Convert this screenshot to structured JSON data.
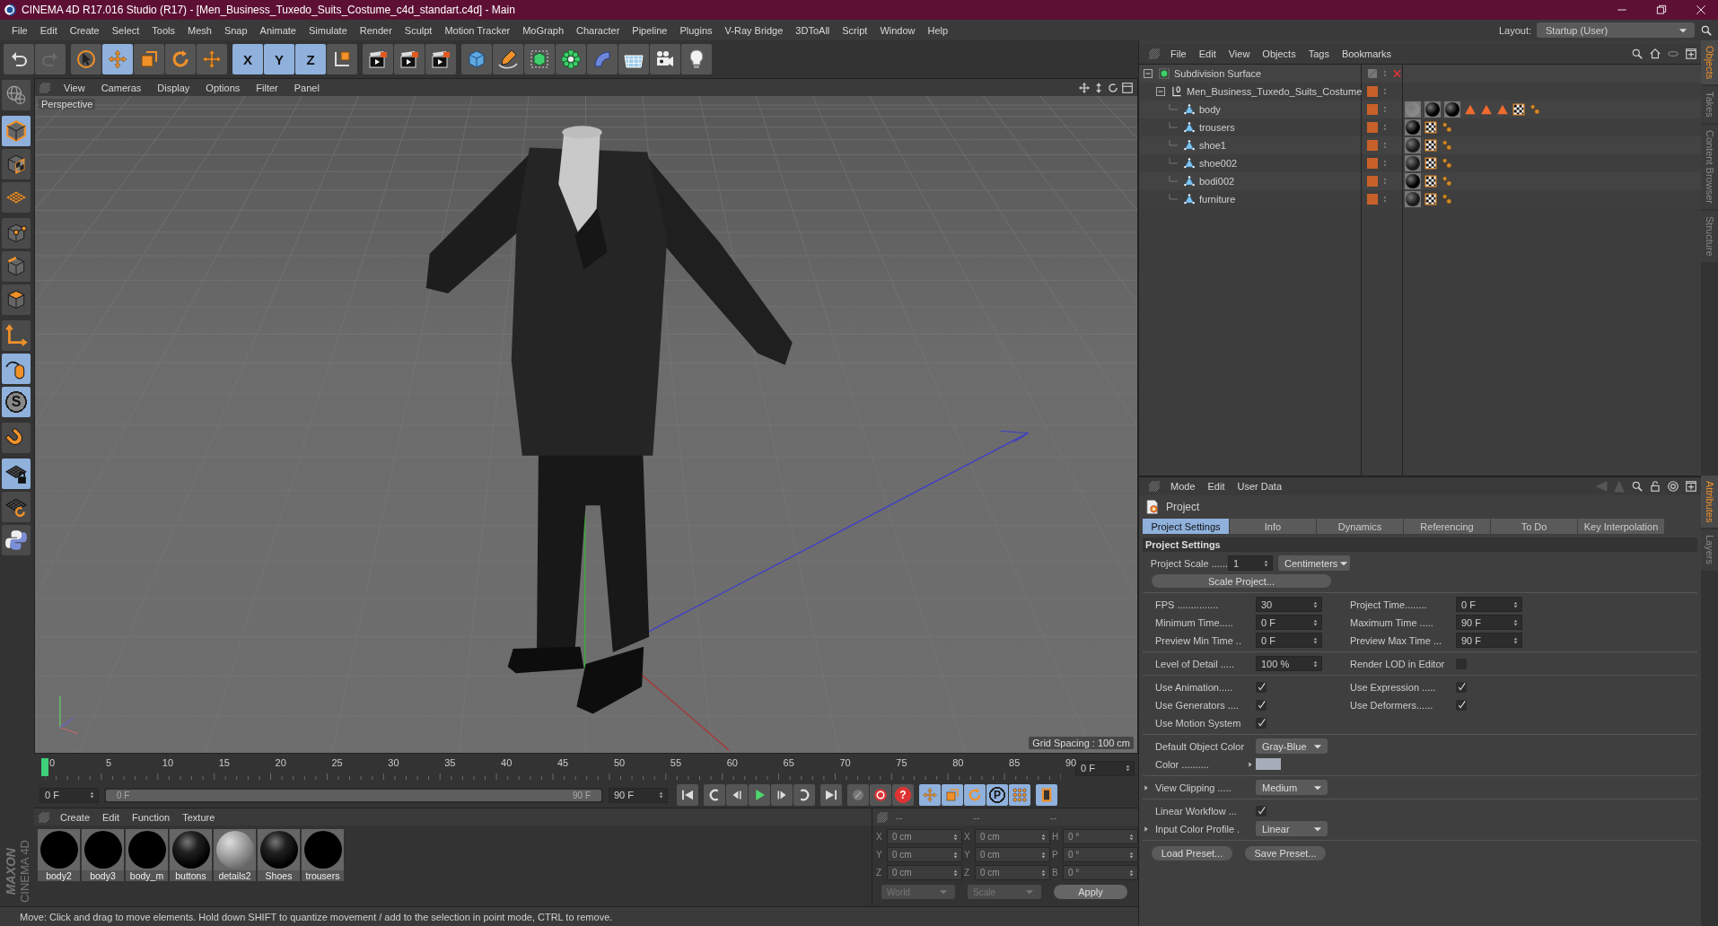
{
  "window": {
    "title": "CINEMA 4D R17.016 Studio (R17) - [Men_Business_Tuxedo_Suits_Costume_c4d_standart.c4d] - Main"
  },
  "menu_bar": [
    "File",
    "Edit",
    "Create",
    "Select",
    "Tools",
    "Mesh",
    "Snap",
    "Animate",
    "Simulate",
    "Render",
    "Sculpt",
    "Motion Tracker",
    "MoGraph",
    "Character",
    "Pipeline",
    "Plugins",
    "V-Ray Bridge",
    "3DToAll",
    "Script",
    "Window",
    "Help"
  ],
  "layout": {
    "label": "Layout:",
    "value": "Startup (User)"
  },
  "toolbar": [
    [
      {
        "kind": "undo",
        "selected": false
      },
      {
        "kind": "redo",
        "selected": false
      }
    ],
    [
      {
        "kind": "cursor",
        "selected": false
      },
      {
        "kind": "move",
        "selected": true
      },
      {
        "kind": "scale",
        "selected": false
      },
      {
        "kind": "rotate",
        "selected": false
      },
      {
        "kind": "moveplus",
        "selected": false
      }
    ],
    [
      {
        "kind": "axislock",
        "label": "X",
        "selected": true
      },
      {
        "kind": "axislock",
        "label": "Y",
        "selected": true
      },
      {
        "kind": "axislock",
        "label": "Z",
        "selected": true
      },
      {
        "kind": "axes",
        "selected": false
      }
    ],
    [
      {
        "kind": "render",
        "selected": false
      },
      {
        "kind": "render",
        "selected": false
      },
      {
        "kind": "render",
        "selected": false
      }
    ],
    [
      {
        "kind": "cube",
        "selected": false
      },
      {
        "kind": "pen",
        "selected": false
      },
      {
        "kind": "subdiv",
        "selected": false
      },
      {
        "kind": "cloner",
        "selected": false
      },
      {
        "kind": "bend",
        "selected": false
      },
      {
        "kind": "floor",
        "selected": false
      },
      {
        "kind": "camera",
        "selected": false
      },
      {
        "kind": "bulb",
        "selected": false
      }
    ]
  ],
  "left_toolbar": [
    [
      {
        "kind": "globe",
        "selected": false
      }
    ],
    [
      {
        "kind": "cubeoutline",
        "selected": true
      },
      {
        "kind": "checkercube",
        "selected": false
      },
      {
        "kind": "gridplane",
        "selected": false
      }
    ],
    [
      {
        "kind": "cubepoints",
        "selected": false
      },
      {
        "kind": "cubeedges",
        "selected": false
      },
      {
        "kind": "cubeface",
        "selected": false
      }
    ],
    [
      {
        "kind": "axisl",
        "selected": false
      },
      {
        "kind": "mouse",
        "selected": true
      },
      {
        "kind": "sculpt",
        "label": "S",
        "selected": true
      }
    ],
    [
      {
        "kind": "magnet",
        "selected": false
      }
    ],
    [
      {
        "kind": "gridlock",
        "selected": true
      },
      {
        "kind": "gridrotate",
        "selected": false
      },
      {
        "kind": "python",
        "selected": false
      }
    ]
  ],
  "brand": {
    "company": "MAXON",
    "product": "CINEMA 4D"
  },
  "viewport": {
    "menu": [
      "View",
      "Cameras",
      "Display",
      "Options",
      "Filter",
      "Panel"
    ],
    "label": "Perspective",
    "grid_spacing": "Grid Spacing : 100 cm"
  },
  "timeline": {
    "ticks": [
      "0",
      "5",
      "10",
      "15",
      "20",
      "25",
      "30",
      "35",
      "40",
      "45",
      "50",
      "55",
      "60",
      "65",
      "70",
      "75",
      "80",
      "85",
      "90"
    ],
    "frame_field": "0 F"
  },
  "transport": {
    "start_field": "0 F",
    "range": {
      "start": "0 F",
      "end": "90 F",
      "level": 1
    },
    "end_field": "90 F",
    "buttons": [
      [
        {
          "kind": "first",
          "selected": false
        }
      ],
      [
        {
          "kind": "prevkey",
          "selected": false
        },
        {
          "kind": "stepback",
          "selected": false
        },
        {
          "kind": "play",
          "selected": false
        },
        {
          "kind": "stepfwd",
          "selected": false
        },
        {
          "kind": "nextkey",
          "selected": false
        }
      ],
      [
        {
          "kind": "last",
          "selected": false
        }
      ],
      [
        {
          "kind": "key",
          "selected": false
        },
        {
          "kind": "record",
          "selected": false
        },
        {
          "kind": "question",
          "label": "?",
          "selected": false
        }
      ],
      [
        {
          "kind": "move",
          "selected": true
        },
        {
          "kind": "scale",
          "selected": true
        },
        {
          "kind": "rotate",
          "selected": true
        },
        {
          "kind": "pmode",
          "label": "P",
          "selected": true
        },
        {
          "kind": "dots",
          "selected": true
        }
      ],
      [
        {
          "kind": "film",
          "selected": true
        }
      ]
    ]
  },
  "material_manager": {
    "menu": [
      "Create",
      "Edit",
      "Function",
      "Texture"
    ],
    "materials": [
      {
        "name": "body2",
        "kind": "matte"
      },
      {
        "name": "body3",
        "kind": "matte"
      },
      {
        "name": "body_m",
        "kind": "matte"
      },
      {
        "name": "buttons",
        "kind": "glossy"
      },
      {
        "name": "details2",
        "kind": "gray"
      },
      {
        "name": "Shoes",
        "kind": "glossy"
      },
      {
        "name": "trousers",
        "kind": "matte"
      }
    ]
  },
  "coordinates": {
    "headers": [
      "--",
      "--",
      "--"
    ],
    "rows": [
      [
        {
          "label": "X",
          "value": "0 cm"
        },
        {
          "label": "X",
          "value": "0 cm"
        },
        {
          "label": "H",
          "value": "0 °"
        }
      ],
      [
        {
          "label": "Y",
          "value": "0 cm"
        },
        {
          "label": "Y",
          "value": "0 cm"
        },
        {
          "label": "P",
          "value": "0 °"
        }
      ],
      [
        {
          "label": "Z",
          "value": "0 cm"
        },
        {
          "label": "Z",
          "value": "0 cm"
        },
        {
          "label": "B",
          "value": "0 °"
        }
      ]
    ],
    "dropdowns": [
      "World",
      "Scale"
    ],
    "apply": "Apply"
  },
  "status_bar": "Move: Click and drag to move elements. Hold down SHIFT to quantize movement / add to the selection in point mode, CTRL to remove.",
  "object_manager": {
    "menu": [
      "File",
      "Edit",
      "View",
      "Objects",
      "Tags",
      "Bookmarks"
    ],
    "objects": [
      {
        "name": "Subdivision Surface",
        "kind": "subdiv",
        "expanded": true,
        "enabled": false,
        "children": [
          {
            "name": "Men_Business_Tuxedo_Suits_Costume",
            "kind": "null",
            "expanded": true,
            "children": [
              {
                "name": "body",
                "kind": "polygon",
                "tags": [
                  {
                    "kind": "material",
                    "color": "#8a8a8a"
                  },
                  {
                    "kind": "material",
                    "color": "#000000"
                  },
                  {
                    "kind": "material",
                    "color": "#000000"
                  },
                  {
                    "kind": "selection"
                  },
                  {
                    "kind": "selection"
                  },
                  {
                    "kind": "selection"
                  },
                  {
                    "kind": "texture"
                  },
                  {
                    "kind": "uvw"
                  }
                ]
              },
              {
                "name": "trousers",
                "kind": "polygon",
                "tags": [
                  {
                    "kind": "material",
                    "color": "#000000"
                  },
                  {
                    "kind": "texture"
                  },
                  {
                    "kind": "uvw"
                  }
                ]
              },
              {
                "name": "shoe1",
                "kind": "polygon",
                "tags": [
                  {
                    "kind": "material",
                    "color": "#1a1a1a"
                  },
                  {
                    "kind": "texture"
                  },
                  {
                    "kind": "uvw"
                  }
                ]
              },
              {
                "name": "shoe002",
                "kind": "polygon",
                "tags": [
                  {
                    "kind": "material",
                    "color": "#1a1a1a"
                  },
                  {
                    "kind": "texture"
                  },
                  {
                    "kind": "uvw"
                  }
                ]
              },
              {
                "name": "bodi002",
                "kind": "polygon",
                "tags": [
                  {
                    "kind": "material",
                    "color": "#000000"
                  },
                  {
                    "kind": "texture"
                  },
                  {
                    "kind": "uvw"
                  }
                ]
              },
              {
                "name": "furniture",
                "kind": "polygon",
                "tags": [
                  {
                    "kind": "material",
                    "color": "#1a1a1a"
                  },
                  {
                    "kind": "texture"
                  },
                  {
                    "kind": "uvw"
                  }
                ]
              }
            ]
          }
        ]
      }
    ]
  },
  "side_tabs_top": [
    {
      "label": "Objects",
      "selected": true
    },
    {
      "label": "Takes",
      "selected": false
    },
    {
      "label": "Content Browser",
      "selected": false
    },
    {
      "label": "Structure",
      "selected": false
    }
  ],
  "side_tabs_bottom": [
    {
      "label": "Attributes",
      "selected": true
    },
    {
      "label": "Layers",
      "selected": false
    }
  ],
  "attributes": {
    "menu": [
      "Mode",
      "Edit",
      "User Data"
    ],
    "title": "Project",
    "tabs": [
      {
        "label": "Project Settings",
        "selected": true
      },
      {
        "label": "Info",
        "selected": false
      },
      {
        "label": "Dynamics",
        "selected": false
      },
      {
        "label": "Referencing",
        "selected": false
      },
      {
        "label": "To Do",
        "selected": false
      },
      {
        "label": "Key Interpolation",
        "selected": false
      }
    ],
    "section": "Project Settings",
    "groups": [
      [
        [
          {
            "label": "Project Scale ......",
            "kind": "number",
            "value": "1",
            "unit": "Centimeters"
          }
        ],
        [
          {
            "kind": "button",
            "value": "Scale Project..."
          }
        ]
      ],
      [
        [
          {
            "label": "FPS ...............",
            "kind": "number",
            "value": "30"
          },
          {
            "label": "Project Time........",
            "kind": "number",
            "value": "0 F"
          }
        ],
        [
          {
            "label": "Minimum Time.....",
            "kind": "number",
            "value": "0 F"
          },
          {
            "label": "Maximum Time .....",
            "kind": "number",
            "value": "90 F"
          }
        ],
        [
          {
            "label": "Preview Min Time ..",
            "kind": "number",
            "value": "0 F"
          },
          {
            "label": "Preview Max Time ...",
            "kind": "number",
            "value": "90 F"
          }
        ]
      ],
      [
        [
          {
            "label": "Level of Detail .....",
            "kind": "number",
            "value": "100 %"
          },
          {
            "label": "Render LOD in Editor",
            "kind": "checkbox",
            "checked": false
          }
        ]
      ],
      [
        [
          {
            "label": "Use Animation.....",
            "kind": "checkbox",
            "checked": true
          },
          {
            "label": "Use Expression .....",
            "kind": "checkbox",
            "checked": true
          }
        ],
        [
          {
            "label": "Use Generators ....",
            "kind": "checkbox",
            "checked": true
          },
          {
            "label": "Use Deformers......",
            "kind": "checkbox",
            "checked": true
          }
        ],
        [
          {
            "label": "Use Motion System",
            "kind": "checkbox",
            "checked": true
          }
        ]
      ],
      [
        [
          {
            "label": "Default Object Color",
            "kind": "dropdown",
            "value": "Gray-Blue"
          }
        ],
        [
          {
            "label": "Color ..........",
            "kind": "swatch",
            "color": "#a6adb8",
            "expanded": false
          }
        ]
      ],
      [
        [
          {
            "label": "View Clipping .....",
            "kind": "dropdown",
            "value": "Medium",
            "expanded": false
          }
        ]
      ],
      [
        [
          {
            "label": "Linear Workflow ...",
            "kind": "checkbox",
            "checked": true
          }
        ],
        [
          {
            "label": "Input Color Profile .",
            "kind": "dropdown",
            "value": "Linear",
            "expanded": false
          }
        ]
      ]
    ],
    "footer": [
      "Load Preset...",
      "Save Preset..."
    ]
  }
}
